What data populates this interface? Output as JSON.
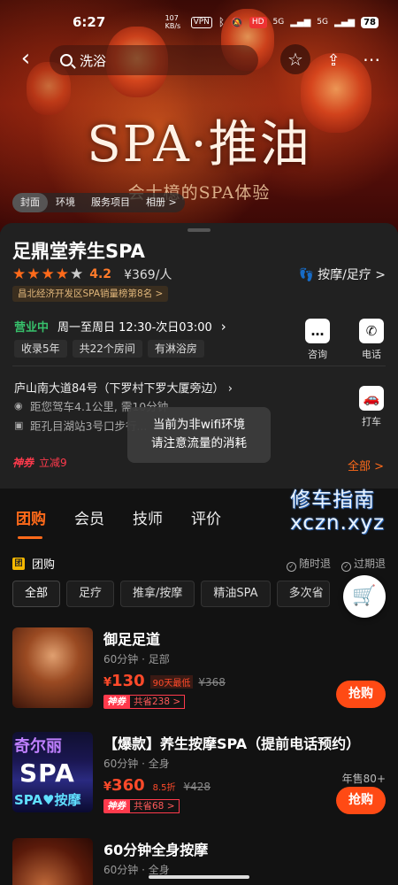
{
  "status_bar": {
    "time": "6:27",
    "speed": "107 KB/s",
    "vpn": "VPN",
    "hd": "HD",
    "signal1": "5G",
    "signal2": "5G",
    "battery": "78"
  },
  "nav": {
    "search_value": "洗浴"
  },
  "hero": {
    "title": "SPA·推油",
    "subtitle": "会士檍的SPA体验"
  },
  "gallery_tabs": [
    "封面",
    "环境",
    "服务项目",
    "相册 >"
  ],
  "shop": {
    "name": "足鼎堂养生SPA",
    "rating": "4.2",
    "price": "¥369/人",
    "category": "按摩/足疗 >",
    "rank": "昌北经济开发区SPA销量榜第8名 >",
    "status": "营业中",
    "hours": "周一至周日 12:30-次日03:00",
    "tags": [
      "收录5年",
      "共22个房间",
      "有淋浴房"
    ],
    "address": "庐山南大道84号（下罗村下罗大厦旁边）",
    "distance": "距您驾车4.1公里, 需10分钟",
    "metro": "距孔目湖站3号口步行..."
  },
  "actions": {
    "consult": "咨询",
    "call": "电话",
    "taxi": "打车"
  },
  "promo": {
    "brand": "神券",
    "discount": "立减9",
    "all": "全部 >"
  },
  "toast": {
    "line1": "当前为非wifi环境",
    "line2": "请注意流量的消耗"
  },
  "main_tabs": [
    "团购",
    "会员",
    "技师",
    "评价"
  ],
  "watermark": {
    "line1": "修车指南",
    "line2": "xczn.xyz"
  },
  "group": {
    "label": "团购",
    "icon_text": "团",
    "refund_any": "随时退",
    "refund_expired": "过期退"
  },
  "chips": [
    "全部",
    "足疗",
    "推拿/按摩",
    "精油SPA",
    "多次省"
  ],
  "deals": [
    {
      "title": "御足足道",
      "meta": "60分钟 · 足部",
      "price": "130",
      "badge": "90天最低",
      "original": "¥368",
      "coupon_brand": "神券",
      "coupon": "共省238 >",
      "buy": "抢购"
    },
    {
      "title": "【爆款】养生按摩SPA（提前电话预约）",
      "meta": "60分钟 · 全身",
      "price": "360",
      "badge": "8.5折",
      "original": "¥428",
      "coupon_brand": "神券",
      "coupon": "共省68 >",
      "sold": "年售80+",
      "buy": "抢购",
      "thumb_text1": "奇尔丽",
      "thumb_text2": "SPA",
      "thumb_text3": "SPA♥按摩"
    },
    {
      "title": "60分钟全身按摩",
      "meta": "60分钟 · 全身"
    }
  ]
}
